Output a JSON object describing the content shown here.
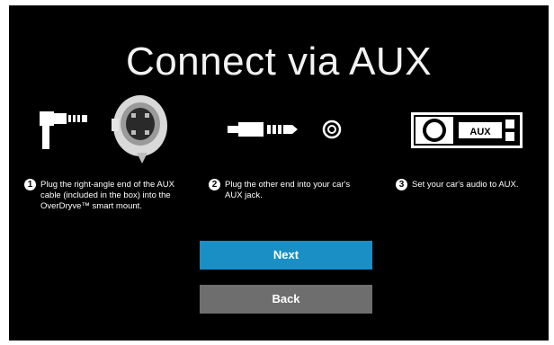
{
  "title": "Connect via AUX",
  "steps": [
    {
      "number": "1",
      "text": "Plug the right-angle end of the AUX cable (included in the box) into the OverDryve™ smart mount."
    },
    {
      "number": "2",
      "text": "Plug the other end into your car's AUX jack."
    },
    {
      "number": "3",
      "text": "Set your car's audio to AUX."
    }
  ],
  "stereo_label": "AUX",
  "buttons": {
    "next": "Next",
    "back": "Back"
  },
  "colors": {
    "background": "#000000",
    "next_button": "#1a8fc6",
    "back_button": "#6e6e6e"
  },
  "icons": [
    "right-angle-plug-icon",
    "smart-mount-icon",
    "aux-cable-icon",
    "aux-jack-icon",
    "car-stereo-icon"
  ]
}
